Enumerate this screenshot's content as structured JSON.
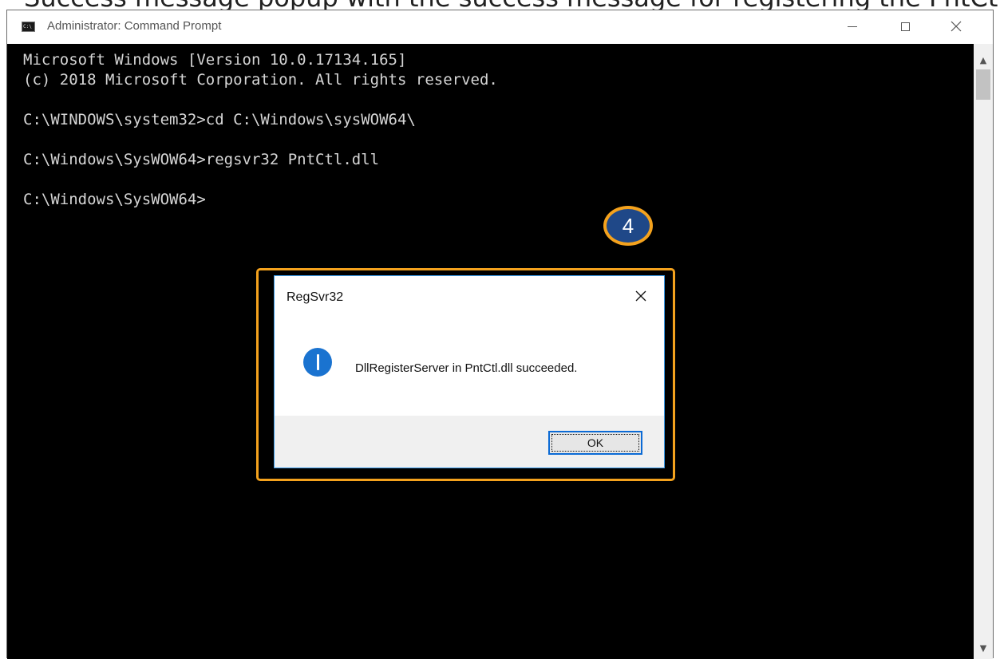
{
  "top_strip": {
    "text": "Success message popup with the success message for registering the PntCtl.dll"
  },
  "window": {
    "title": "Administrator: Command Prompt",
    "icon": "cmd-window-icon",
    "icon_text": "C:\\"
  },
  "console": {
    "lines": [
      "Microsoft Windows [Version 10.0.17134.165]",
      "(c) 2018 Microsoft Corporation. All rights reserved.",
      "",
      "C:\\WINDOWS\\system32>cd C:\\Windows\\sysWOW64\\",
      "",
      "C:\\Windows\\SysWOW64>regsvr32 PntCtl.dll",
      "",
      "C:\\Windows\\SysWOW64>"
    ]
  },
  "annotation": {
    "step_number": "4",
    "color": "#f4a21d",
    "badge_color": "#1f4888"
  },
  "dialog": {
    "title": "RegSvr32",
    "message": "DllRegisterServer in PntCtl.dll succeeded.",
    "icon": "info-icon",
    "ok_label": "OK"
  }
}
